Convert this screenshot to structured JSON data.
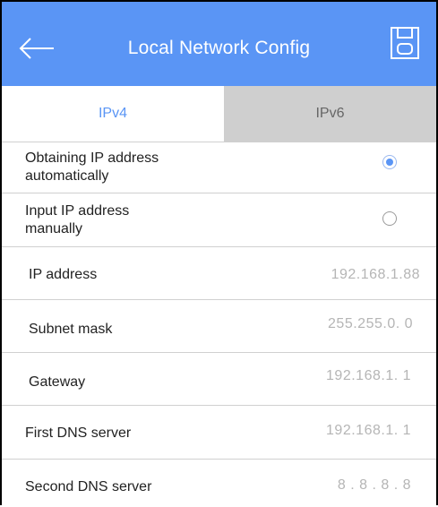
{
  "header": {
    "title": "Local Network Config",
    "back_icon": "arrow-left-icon",
    "save_icon": "save-icon",
    "color": "#5a95f5"
  },
  "tabs": [
    {
      "label": "IPv4",
      "selected": true
    },
    {
      "label": "IPv6",
      "selected": false
    }
  ],
  "options": {
    "auto_line1": "Obtaining IP address",
    "auto_line2": "automatically",
    "auto_selected": true,
    "manual_line1": "Input IP address",
    "manual_line2": "manually",
    "manual_selected": false
  },
  "fields": [
    {
      "label": "IP address",
      "value": "192.168.1.88"
    },
    {
      "label": "Subnet mask",
      "value": "255.255.0. 0"
    },
    {
      "label": "Gateway",
      "value": "192.168.1. 1"
    },
    {
      "label": "First DNS server",
      "value": "192.168.1. 1"
    },
    {
      "label": "Second DNS server",
      "value": "8 . 8 . 8 . 8"
    }
  ]
}
